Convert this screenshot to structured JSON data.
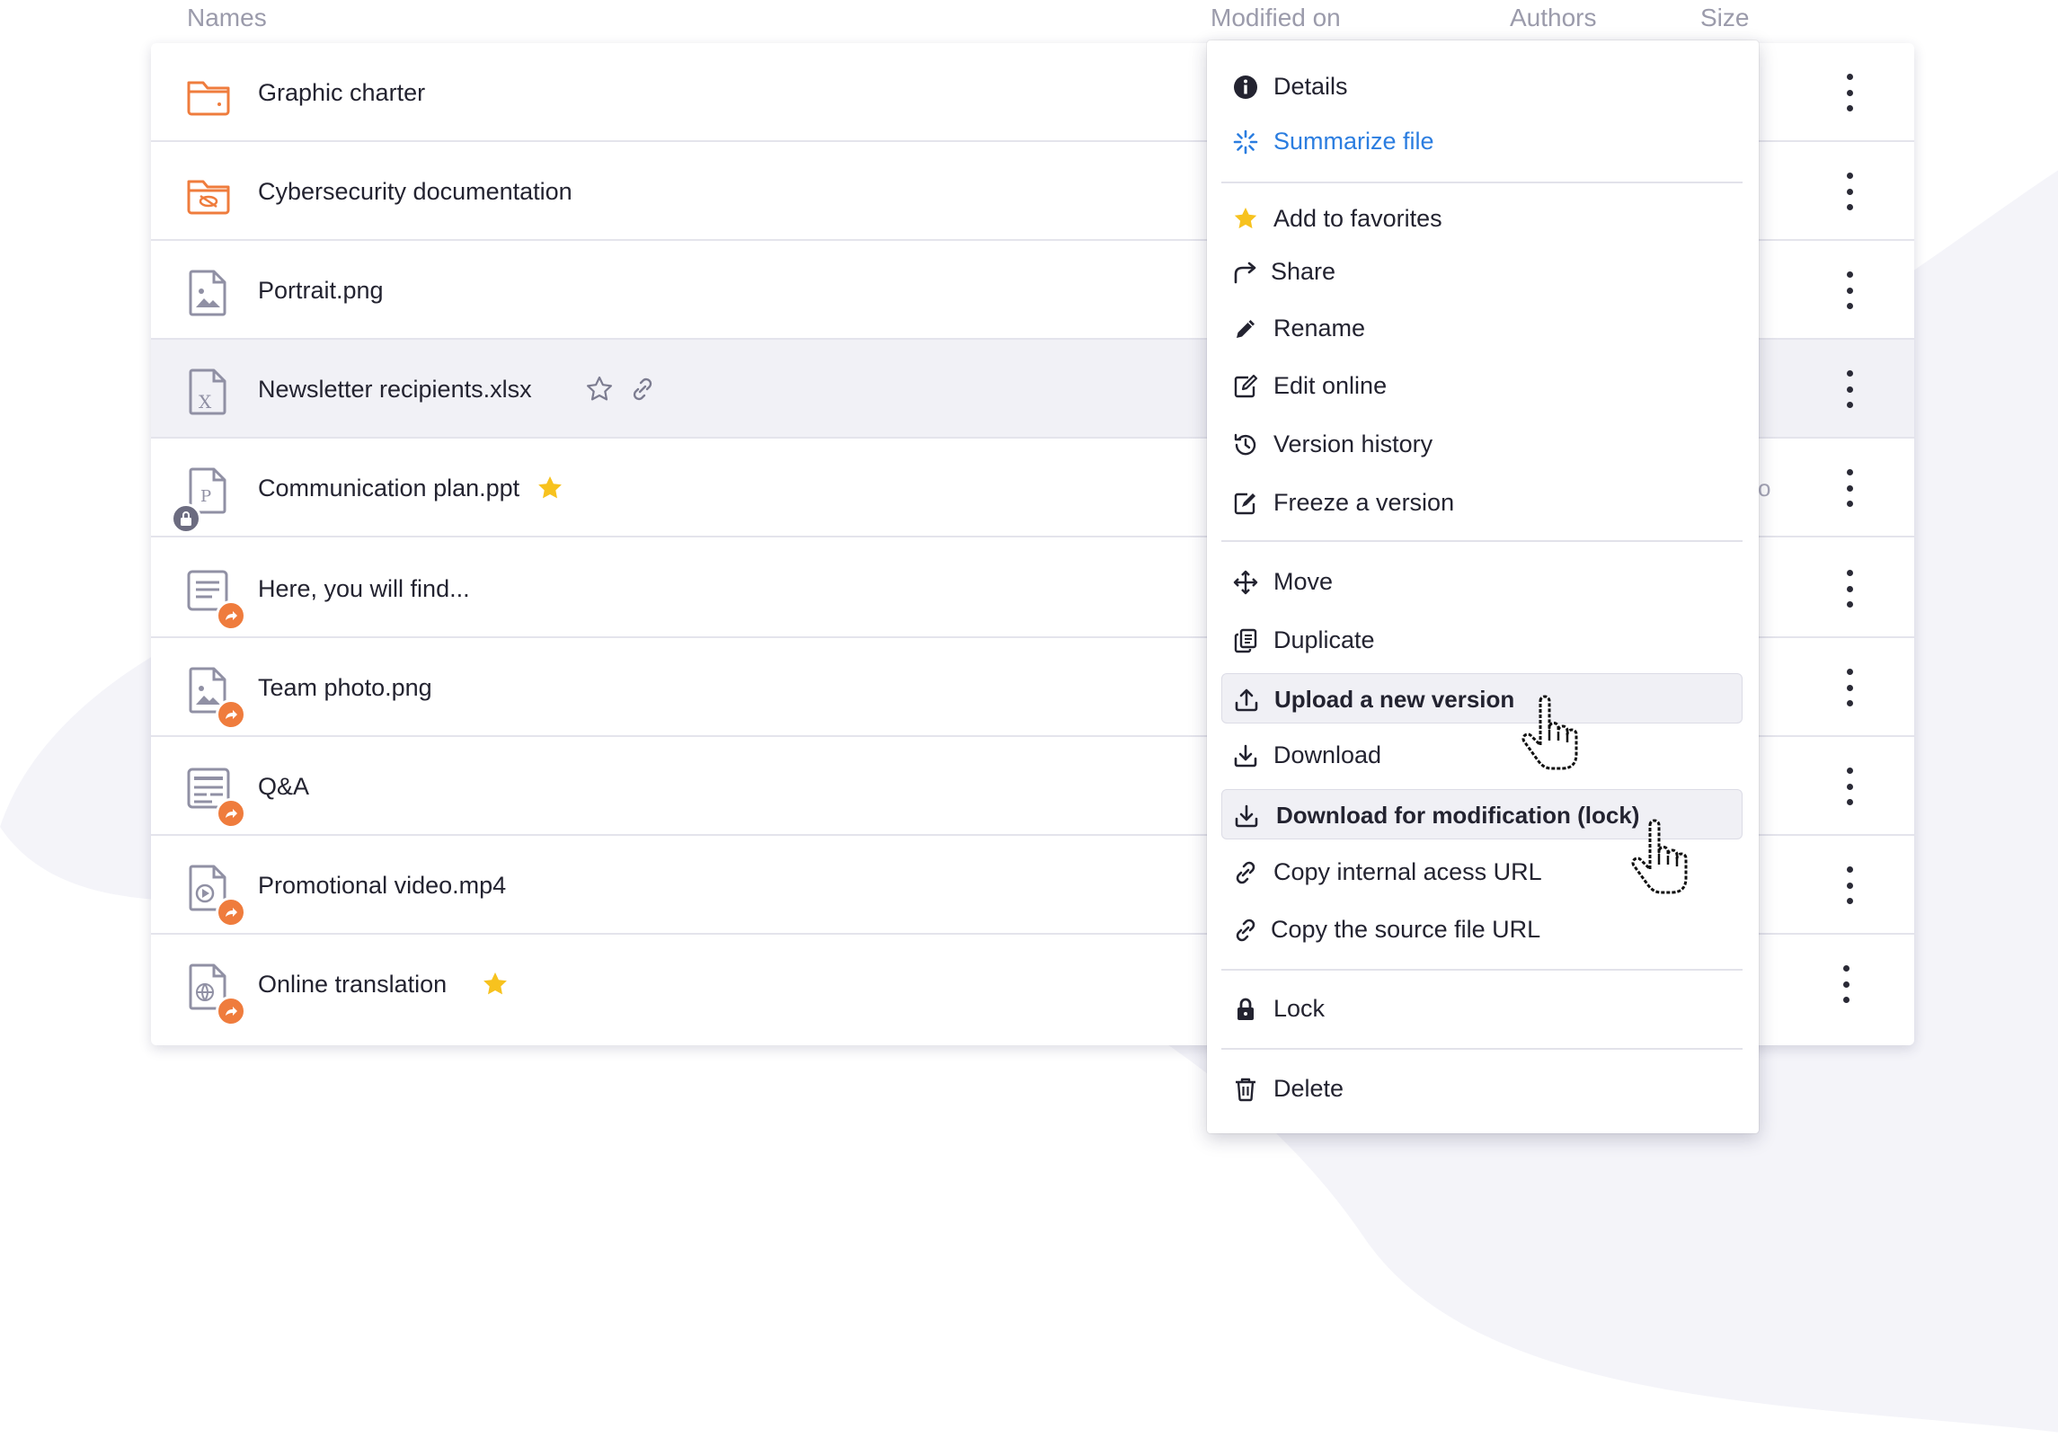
{
  "header": {
    "names": "Names",
    "modified_on": "Modified on",
    "authors": "Authors",
    "size": "Size"
  },
  "files": [
    {
      "name": "Graphic charter",
      "icon": "folder-icon"
    },
    {
      "name": "Cybersecurity documentation",
      "icon": "hidden-folder-icon"
    },
    {
      "name": "Portrait.png",
      "icon": "image-file-icon"
    },
    {
      "name": "Newsletter recipients.xlsx",
      "icon": "spreadsheet-file-icon"
    },
    {
      "name": "Communication plan.ppt",
      "icon": "presentation-file-icon",
      "ghost": "o"
    },
    {
      "name": "Here, you will find...",
      "icon": "text-file-icon"
    },
    {
      "name": "Team photo.png",
      "icon": "image-file-icon"
    },
    {
      "name": "Q&A",
      "icon": "form-file-icon"
    },
    {
      "name": "Promotional video.mp4",
      "icon": "video-file-icon"
    },
    {
      "name": "Online translation",
      "icon": "web-file-icon"
    }
  ],
  "menu": {
    "details": "Details",
    "summarize": "Summarize file",
    "favorites": "Add to favorites",
    "share": "Share",
    "rename": "Rename",
    "edit_online": "Edit online",
    "version_history": "Version history",
    "freeze": "Freeze a version",
    "move": "Move",
    "duplicate": "Duplicate",
    "upload_version": "Upload a new version",
    "download": "Download",
    "download_lock": "Download for modification (lock)",
    "copy_internal": "Copy internal acess URL",
    "copy_source": "Copy the source file URL",
    "lock": "Lock",
    "delete": "Delete"
  },
  "colors": {
    "accent_orange": "#ef7c3d",
    "accent_blue": "#2b7de0",
    "star_yellow": "#f7c21e",
    "icon_gray": "#9090a4"
  }
}
